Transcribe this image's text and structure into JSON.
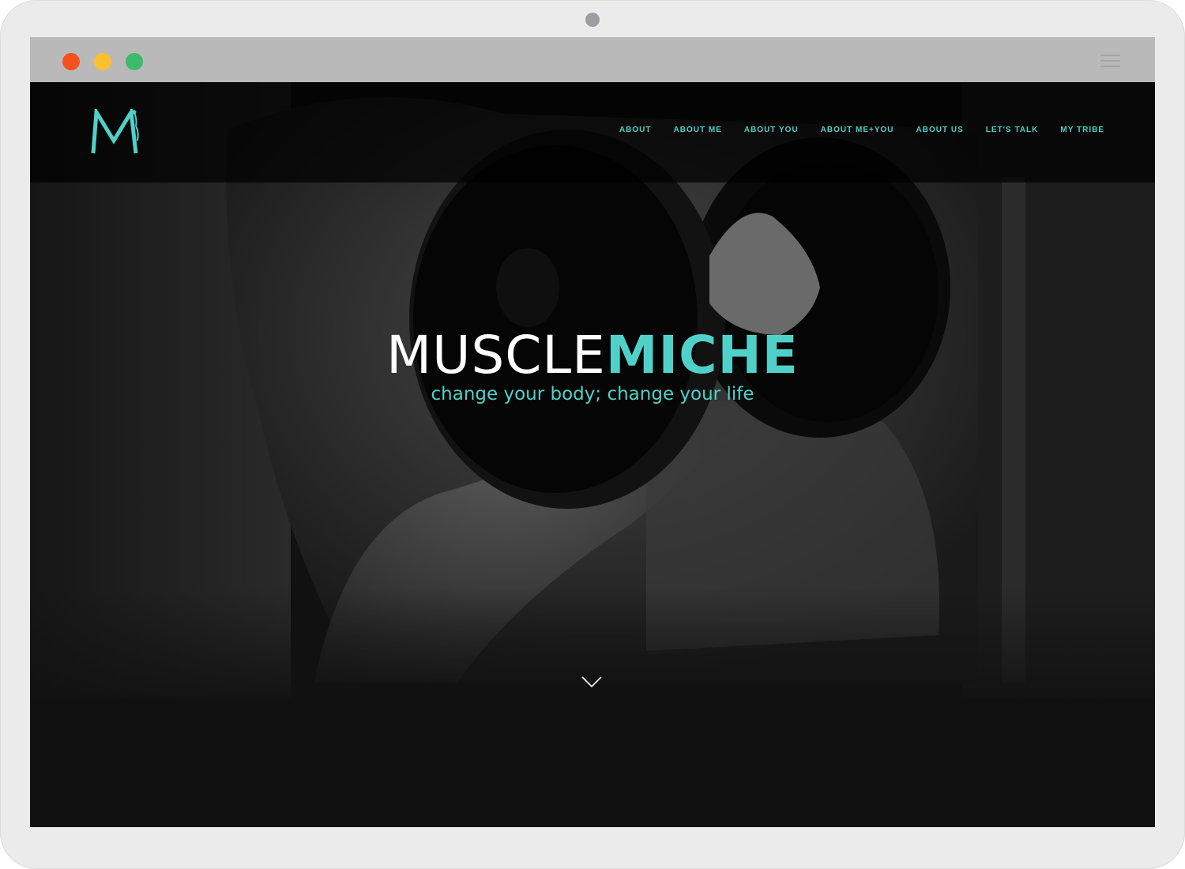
{
  "window": {
    "controls": [
      "close",
      "minimize",
      "maximize"
    ],
    "menu_icon": "hamburger-menu-icon"
  },
  "site": {
    "logo_letter": "M",
    "nav": [
      {
        "label": "ABOUT"
      },
      {
        "label": "ABOUT ME"
      },
      {
        "label": "ABOUT YOU"
      },
      {
        "label": "ABOUT ME+YOU"
      },
      {
        "label": "ABOUT US"
      },
      {
        "label": "LET'S TALK"
      },
      {
        "label": "MY TRIBE"
      }
    ],
    "hero": {
      "title_part1": "MUSCLE",
      "title_part2": "MICHE",
      "tagline": "change your body; change your life",
      "scroll_icon": "chevron-down-icon"
    }
  },
  "colors": {
    "accent": "#4fd1c9",
    "dot_red": "#f4511e",
    "dot_yellow": "#fbc02d",
    "dot_green": "#3dbb6b",
    "background": "#141414"
  }
}
